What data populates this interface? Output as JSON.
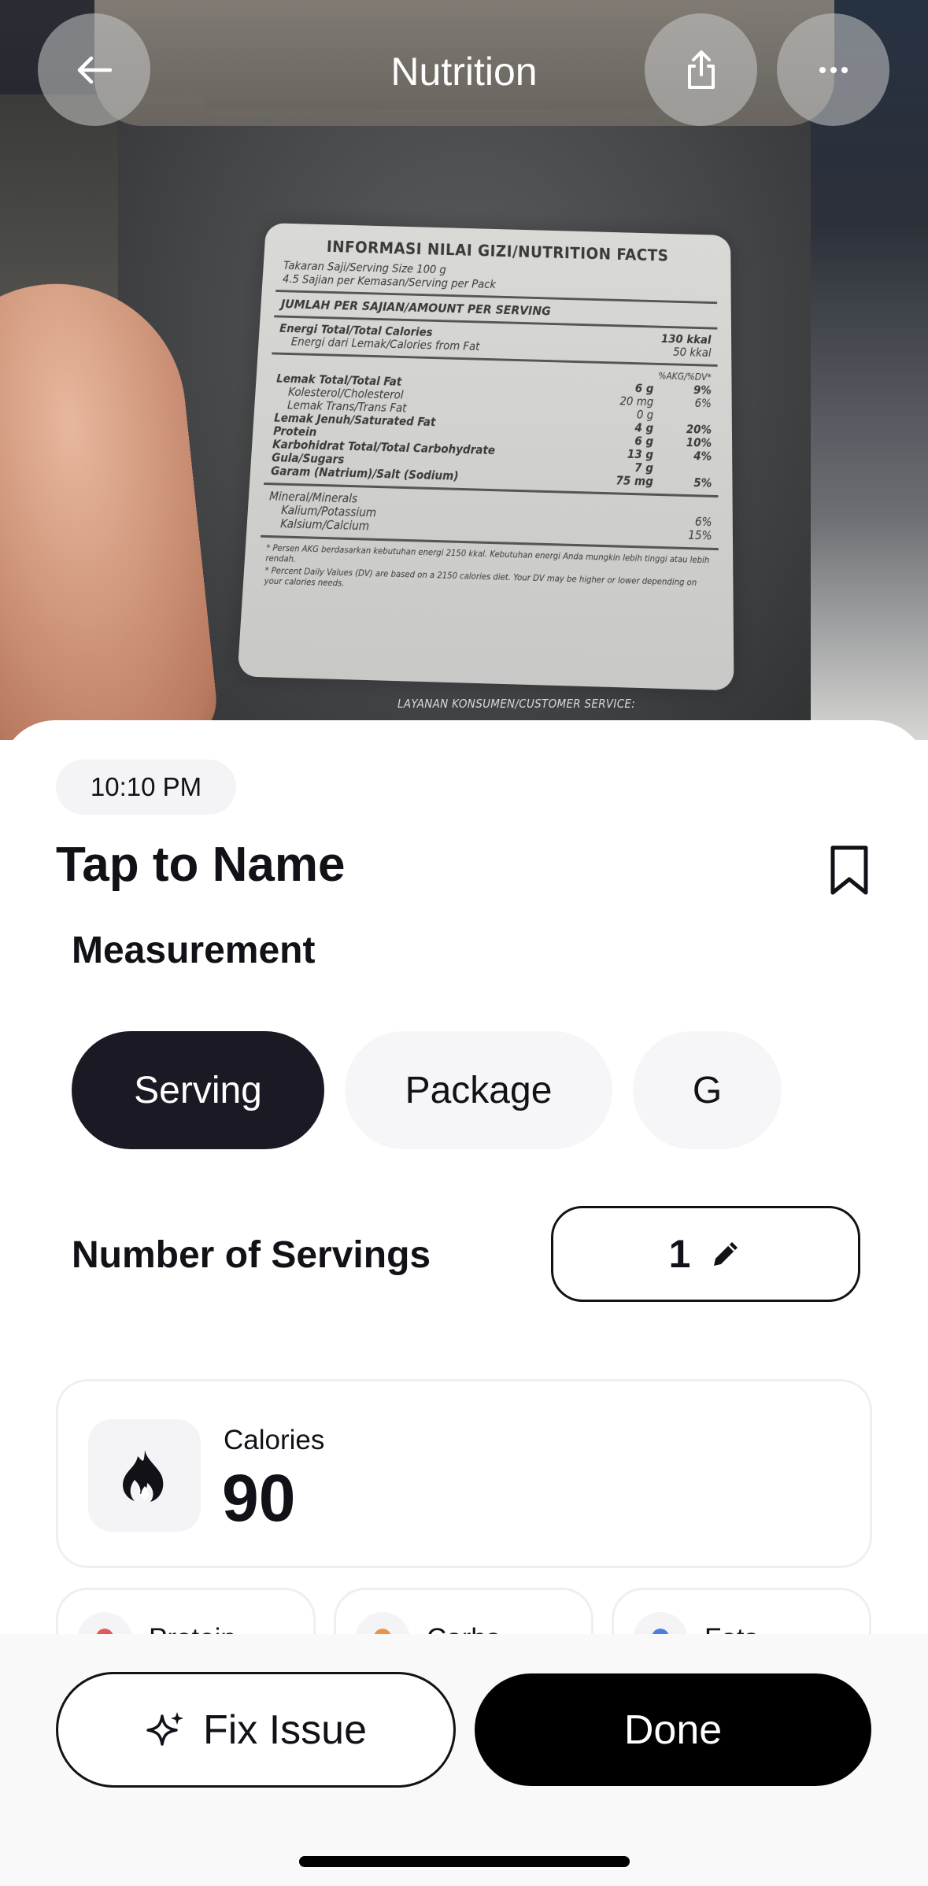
{
  "header": {
    "title": "Nutrition",
    "back_icon": "arrow-left-icon",
    "share_icon": "share-icon",
    "more_icon": "more-dots-icon"
  },
  "photo": {
    "label_title": "INFORMASI NILAI GIZI/NUTRITION FACTS",
    "serving_size": "Takaran Saji/Serving Size 100 g",
    "servings_per_pack": "4.5 Sajian per Kemasan/Serving per Pack",
    "amount_per_serving": "JUMLAH PER SAJIAN/AMOUNT PER SERVING",
    "energy_total": "Energi Total/Total Calories",
    "energy_total_value": "130 kkal",
    "energy_fat": "Energi dari Lemak/Calories from Fat",
    "energy_fat_value": "50 kkal",
    "dv_header": "%AKG/%DV*",
    "rows": [
      {
        "name": "Lemak Total/Total Fat",
        "amount": "6 g",
        "dv": "9%",
        "bold": true,
        "indent": false
      },
      {
        "name": "Kolesterol/Cholesterol",
        "amount": "20 mg",
        "dv": "6%",
        "bold": false,
        "indent": true
      },
      {
        "name": "Lemak Trans/Trans Fat",
        "amount": "0 g",
        "dv": "",
        "bold": false,
        "indent": true
      },
      {
        "name": "Lemak Jenuh/Saturated Fat",
        "amount": "4 g",
        "dv": "20%",
        "bold": true,
        "indent": false
      },
      {
        "name": "Protein",
        "amount": "6 g",
        "dv": "10%",
        "bold": true,
        "indent": false
      },
      {
        "name": "Karbohidrat Total/Total Carbohydrate",
        "amount": "13 g",
        "dv": "4%",
        "bold": true,
        "indent": false
      },
      {
        "name": "Gula/Sugars",
        "amount": "7 g",
        "dv": "",
        "bold": true,
        "indent": false
      },
      {
        "name": "Garam (Natrium)/Salt (Sodium)",
        "amount": "75 mg",
        "dv": "5%",
        "bold": true,
        "indent": false
      }
    ],
    "minerals": "Mineral/Minerals",
    "potassium": "Kalium/Potassium",
    "potassium_dv": "6%",
    "calcium": "Kalsium/Calcium",
    "calcium_dv": "15%",
    "note1": "* Persen AKG berdasarkan kebutuhan energi 2150 kkal. Kebutuhan energi Anda mungkin lebih tinggi atau lebih rendah.",
    "note2": "* Percent Daily Values (DV) are based on a 2150 calories diet. Your DV may be higher or lower depending on your calories needs.",
    "service": "LAYANAN KONSUMEN/CUSTOMER SERVICE:"
  },
  "entry": {
    "time": "10:10 PM",
    "name": "Tap to Name",
    "bookmark_icon": "bookmark-icon"
  },
  "measurement": {
    "label": "Measurement",
    "options": [
      "Serving",
      "Package",
      "G"
    ],
    "selected": "Serving"
  },
  "servings": {
    "label": "Number of Servings",
    "value": "1",
    "edit_icon": "pencil-icon"
  },
  "calories": {
    "label": "Calories",
    "value": "90",
    "icon": "flame-icon"
  },
  "macros": [
    {
      "label": "Protein",
      "color": "#e05a5a"
    },
    {
      "label": "Carbs",
      "color": "#e8954a"
    },
    {
      "label": "Fats",
      "color": "#4a7fe0"
    }
  ],
  "actions": {
    "fix_label": "Fix Issue",
    "fix_icon": "sparkle-icon",
    "done_label": "Done"
  }
}
